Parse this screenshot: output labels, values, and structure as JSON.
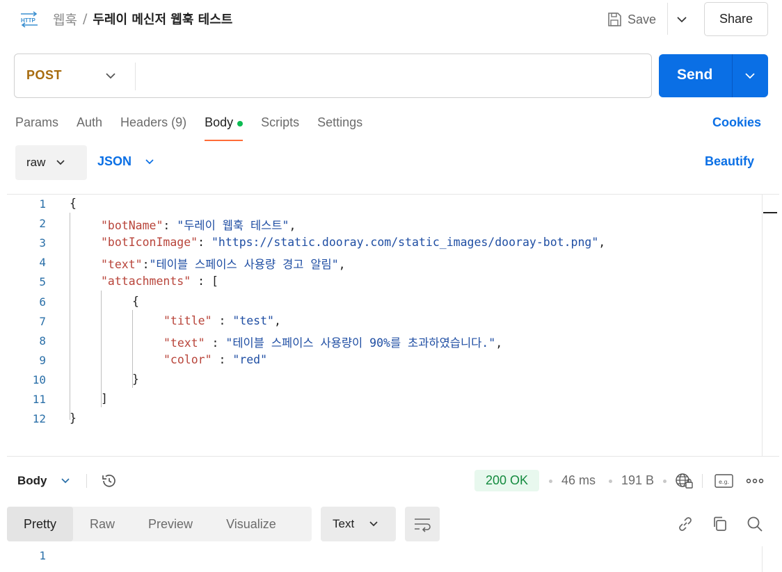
{
  "header": {
    "icon_text": "HTTP",
    "breadcrumb_parent": "웹훅",
    "breadcrumb_sep": "/",
    "title": "두레이 메신저 웹훅 테스트",
    "save_label": "Save",
    "share_label": "Share"
  },
  "request": {
    "method": "POST",
    "url": "",
    "send_label": "Send"
  },
  "tabs": [
    {
      "label": "Params"
    },
    {
      "label": "Auth"
    },
    {
      "label": "Headers (9)"
    },
    {
      "label": "Body",
      "active": true
    },
    {
      "label": "Scripts"
    },
    {
      "label": "Settings"
    }
  ],
  "cookies_label": "Cookies",
  "body_options": {
    "mode": "raw",
    "language": "JSON",
    "beautify_label": "Beautify"
  },
  "editor": {
    "line_numbers": [
      "1",
      "2",
      "3",
      "4",
      "5",
      "6",
      "7",
      "8",
      "9",
      "10",
      "11",
      "12"
    ],
    "lines": [
      [
        {
          "t": "p",
          "v": "{"
        }
      ],
      [
        {
          "t": "k",
          "v": "\"botName\""
        },
        {
          "t": "p",
          "v": ": "
        },
        {
          "t": "s",
          "v": "\"두레이 웹훅 테스트\""
        },
        {
          "t": "p",
          "v": ","
        }
      ],
      [
        {
          "t": "k",
          "v": "\"botIconImage\""
        },
        {
          "t": "p",
          "v": ": "
        },
        {
          "t": "s",
          "v": "\"https://static.dooray.com/static_images/dooray-bot.png\""
        },
        {
          "t": "p",
          "v": ","
        }
      ],
      [
        {
          "t": "k",
          "v": "\"text\""
        },
        {
          "t": "p",
          "v": ":"
        },
        {
          "t": "s",
          "v": "\"테이블 스페이스 사용량 경고 알림\""
        },
        {
          "t": "p",
          "v": ","
        }
      ],
      [
        {
          "t": "k",
          "v": "\"attachments\""
        },
        {
          "t": "p",
          "v": " : ["
        }
      ],
      [
        {
          "t": "p",
          "v": "{"
        }
      ],
      [
        {
          "t": "k",
          "v": "\"title\""
        },
        {
          "t": "p",
          "v": " : "
        },
        {
          "t": "s",
          "v": "\"test\""
        },
        {
          "t": "p",
          "v": ","
        }
      ],
      [
        {
          "t": "k",
          "v": "\"text\""
        },
        {
          "t": "p",
          "v": " : "
        },
        {
          "t": "s",
          "v": "\"테이블 스페이스 사용량이 90%를 초과하였습니다.\""
        },
        {
          "t": "p",
          "v": ","
        }
      ],
      [
        {
          "t": "k",
          "v": "\"color\""
        },
        {
          "t": "p",
          "v": " : "
        },
        {
          "t": "s",
          "v": "\"red\""
        }
      ],
      [
        {
          "t": "p",
          "v": "}"
        }
      ],
      [
        {
          "t": "p",
          "v": "]"
        }
      ],
      [
        {
          "t": "p",
          "v": "}"
        }
      ]
    ],
    "indent_levels": [
      0,
      1,
      1,
      1,
      1,
      2,
      3,
      3,
      3,
      2,
      1,
      0
    ]
  },
  "response": {
    "section_label": "Body",
    "status": "200 OK",
    "time": "46 ms",
    "size": "191 B",
    "view_tabs": [
      {
        "label": "Pretty",
        "active": true
      },
      {
        "label": "Raw"
      },
      {
        "label": "Preview"
      },
      {
        "label": "Visualize"
      }
    ],
    "format": "Text",
    "first_line": "1"
  },
  "colors": {
    "accent": "#0a6fe5",
    "method": "#a76b0e",
    "tab_underline": "#ff6c37",
    "status_ok": "#138a3e",
    "json_key": "#b8443a",
    "json_string": "#1f4ea3"
  },
  "icons": [
    "http-icon",
    "save-icon",
    "chevron-down-icon",
    "history-icon",
    "globe-icon",
    "example-icon",
    "more-icon",
    "wrap-icon",
    "link-icon",
    "copy-icon",
    "search-icon"
  ]
}
